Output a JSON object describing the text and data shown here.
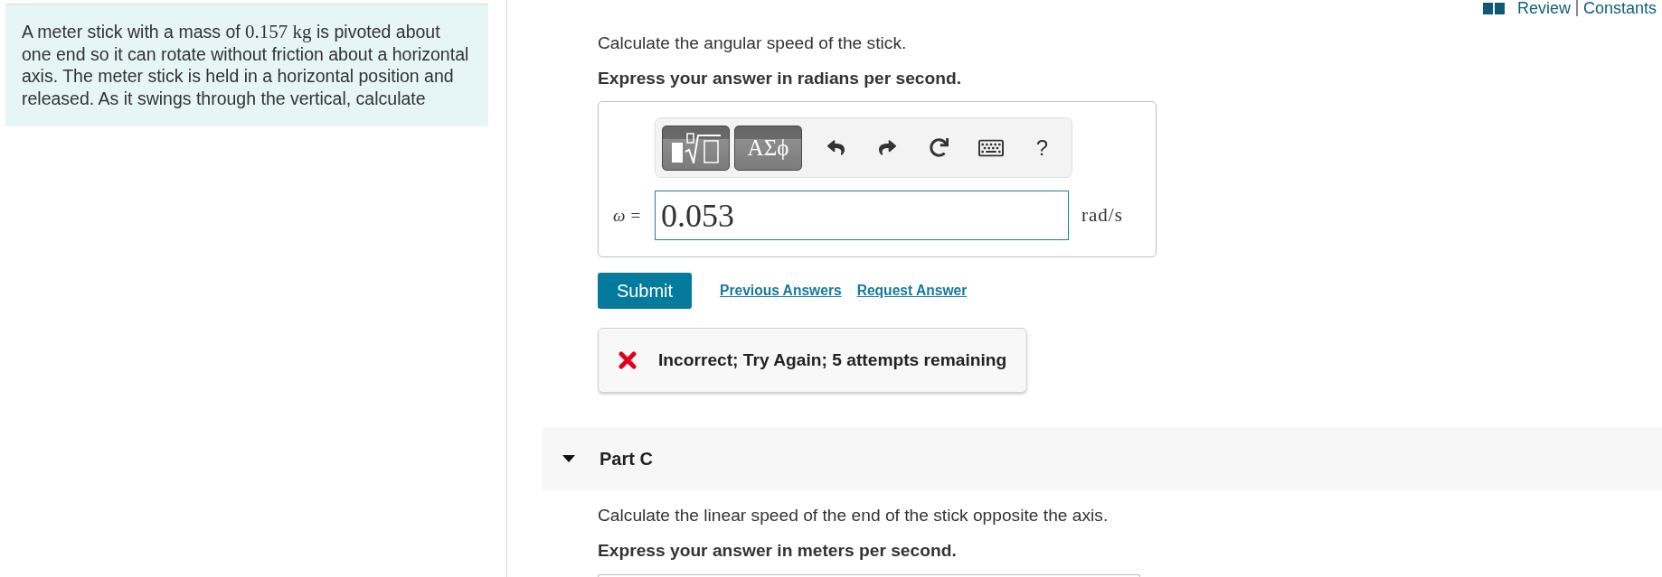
{
  "header": {
    "links": [
      {
        "label": "Review"
      },
      {
        "label": "Constants"
      }
    ]
  },
  "problem": {
    "segments": [
      {
        "kind": "text",
        "text": "A meter stick with a mass of "
      },
      {
        "kind": "math",
        "text": "0.157 kg"
      },
      {
        "kind": "text",
        "text": " is pivoted about one end so it can rotate without friction about a horizontal axis. The meter stick is held in a horizontal position and released. As it swings through the vertical, calculate"
      }
    ]
  },
  "question": {
    "prompt": "Calculate the angular speed of the stick.",
    "instruction": "Express your answer in radians per second.",
    "toolbar": [
      {
        "kind": "templates"
      },
      {
        "kind": "symbols",
        "label": "ΑΣϕ"
      },
      {
        "kind": "undo"
      },
      {
        "kind": "redo"
      },
      {
        "kind": "reset"
      },
      {
        "kind": "keyboard"
      },
      {
        "kind": "help",
        "label": "?"
      }
    ],
    "variable": "ω =",
    "answer": "0.053",
    "unit": "rad/s",
    "submit": "Submit",
    "links": [
      {
        "label": "Previous Answers"
      },
      {
        "label": "Request Answer"
      }
    ],
    "feedback": {
      "kind": "incorrect",
      "message": "Incorrect; Try Again; 5 attempts remaining"
    }
  },
  "next_part": {
    "title": "Part C",
    "expanded": true,
    "prompt": "Calculate the linear speed of the end of the stick opposite the axis.",
    "instruction": "Express your answer in meters per second."
  }
}
